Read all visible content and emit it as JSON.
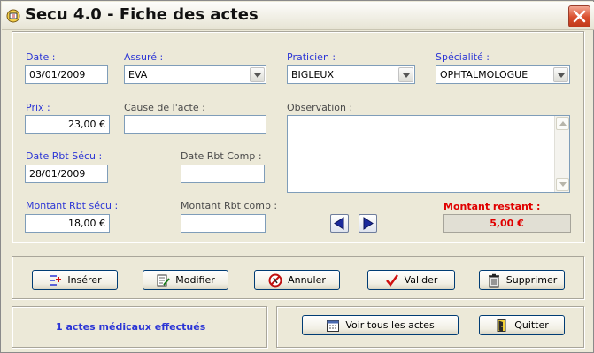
{
  "window": {
    "title": "Secu 4.0 - Fiche des actes"
  },
  "form": {
    "date": {
      "label": "Date :",
      "value": "03/01/2009"
    },
    "assure": {
      "label": "Assuré :",
      "value": "EVA"
    },
    "praticien": {
      "label": "Praticien :",
      "value": "BIGLEUX"
    },
    "specialite": {
      "label": "Spécialité :",
      "value": "OPHTALMOLOGUE"
    },
    "prix": {
      "label": "Prix :",
      "value": "23,00 €"
    },
    "cause": {
      "label": "Cause de l'acte :",
      "value": ""
    },
    "observation": {
      "label": "Observation :",
      "value": ""
    },
    "date_rbt_secu": {
      "label": "Date Rbt Sécu :",
      "value": "28/01/2009"
    },
    "date_rbt_comp": {
      "label": "Date Rbt Comp :",
      "value": ""
    },
    "montant_rbt_secu": {
      "label": "Montant Rbt sécu :",
      "value": "18,00 €"
    },
    "montant_rbt_comp": {
      "label": "Montant Rbt comp :",
      "value": ""
    },
    "montant_restant": {
      "label": "Montant restant :",
      "value": "5,00 €"
    }
  },
  "actions": {
    "inserer": "Insérer",
    "modifier": "Modifier",
    "annuler": "Annuler",
    "valider": "Valider",
    "supprimer": "Supprimer"
  },
  "footer": {
    "count_text": "1 actes médicaux effectués",
    "voir_tous": "Voir tous les actes",
    "quitter": "Quitter"
  },
  "icons": {
    "app": "app-icon",
    "close": "close-icon",
    "prev": "arrow-left-icon",
    "next": "arrow-right-icon",
    "inserer": "insert-icon",
    "modifier": "edit-icon",
    "annuler": "cancel-icon",
    "valider": "checkmark-icon",
    "supprimer": "trash-icon",
    "voir_tous": "calendar-icon",
    "quitter": "exit-door-icon"
  },
  "colors": {
    "label_blue": "#2b35d6",
    "remaining_red": "#e00000",
    "window_bg": "#ECE9D8",
    "close_red": "#d94d2b"
  }
}
